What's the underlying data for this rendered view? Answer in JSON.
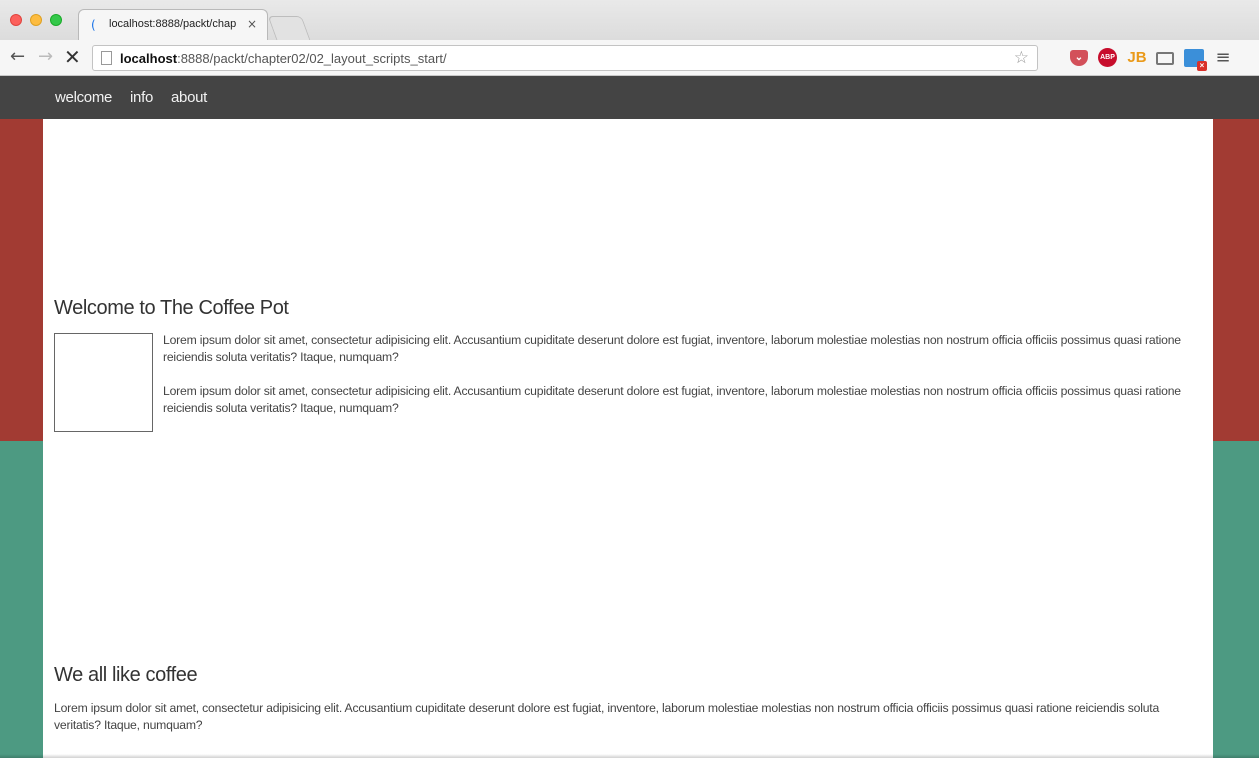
{
  "browser": {
    "tab_title": "localhost:8888/packt/chap",
    "tab_close": "×",
    "url_host": "localhost",
    "url_path": ":8888/packt/chapter02/02_layout_scripts_start/",
    "extensions": [
      "pocket-icon",
      "adblock-plus-icon",
      "jetbrains-icon",
      "cast-icon",
      "screen-capture-icon",
      "chrome-menu-icon"
    ],
    "abp_label": "ABP",
    "jb_label": "JB"
  },
  "site": {
    "nav": {
      "welcome": "welcome",
      "info": "info",
      "about": "about"
    },
    "welcome_section": {
      "heading": "Welcome to The Coffee Pot",
      "paragraphs": [
        "Lorem ipsum dolor sit amet, consectetur adipisicing elit. Accusantium cupiditate deserunt dolore est fugiat, inventore, laborum molestiae molestias non nostrum officia officiis possimus quasi ratione reiciendis soluta veritatis? Itaque, numquam?",
        "Lorem ipsum dolor sit amet, consectetur adipisicing elit. Accusantium cupiditate deserunt dolore est fugiat, inventore, laborum molestiae molestias non nostrum officia officiis possimus quasi ratione reiciendis soluta veritatis? Itaque, numquam?"
      ]
    },
    "coffee_section": {
      "heading": "We all like coffee",
      "paragraph": "Lorem ipsum dolor sit amet, consectetur adipisicing elit. Accusantium cupiditate deserunt dolore est fugiat, inventore, laborum molestiae molestias non nostrum officia officiis possimus quasi ratione reiciendis soluta veritatis? Itaque, numquam?"
    }
  },
  "colors": {
    "nav_bar": "#444444",
    "band_red": "#a23b33",
    "band_green": "#4d9a82",
    "content_bg": "#ffffff"
  }
}
